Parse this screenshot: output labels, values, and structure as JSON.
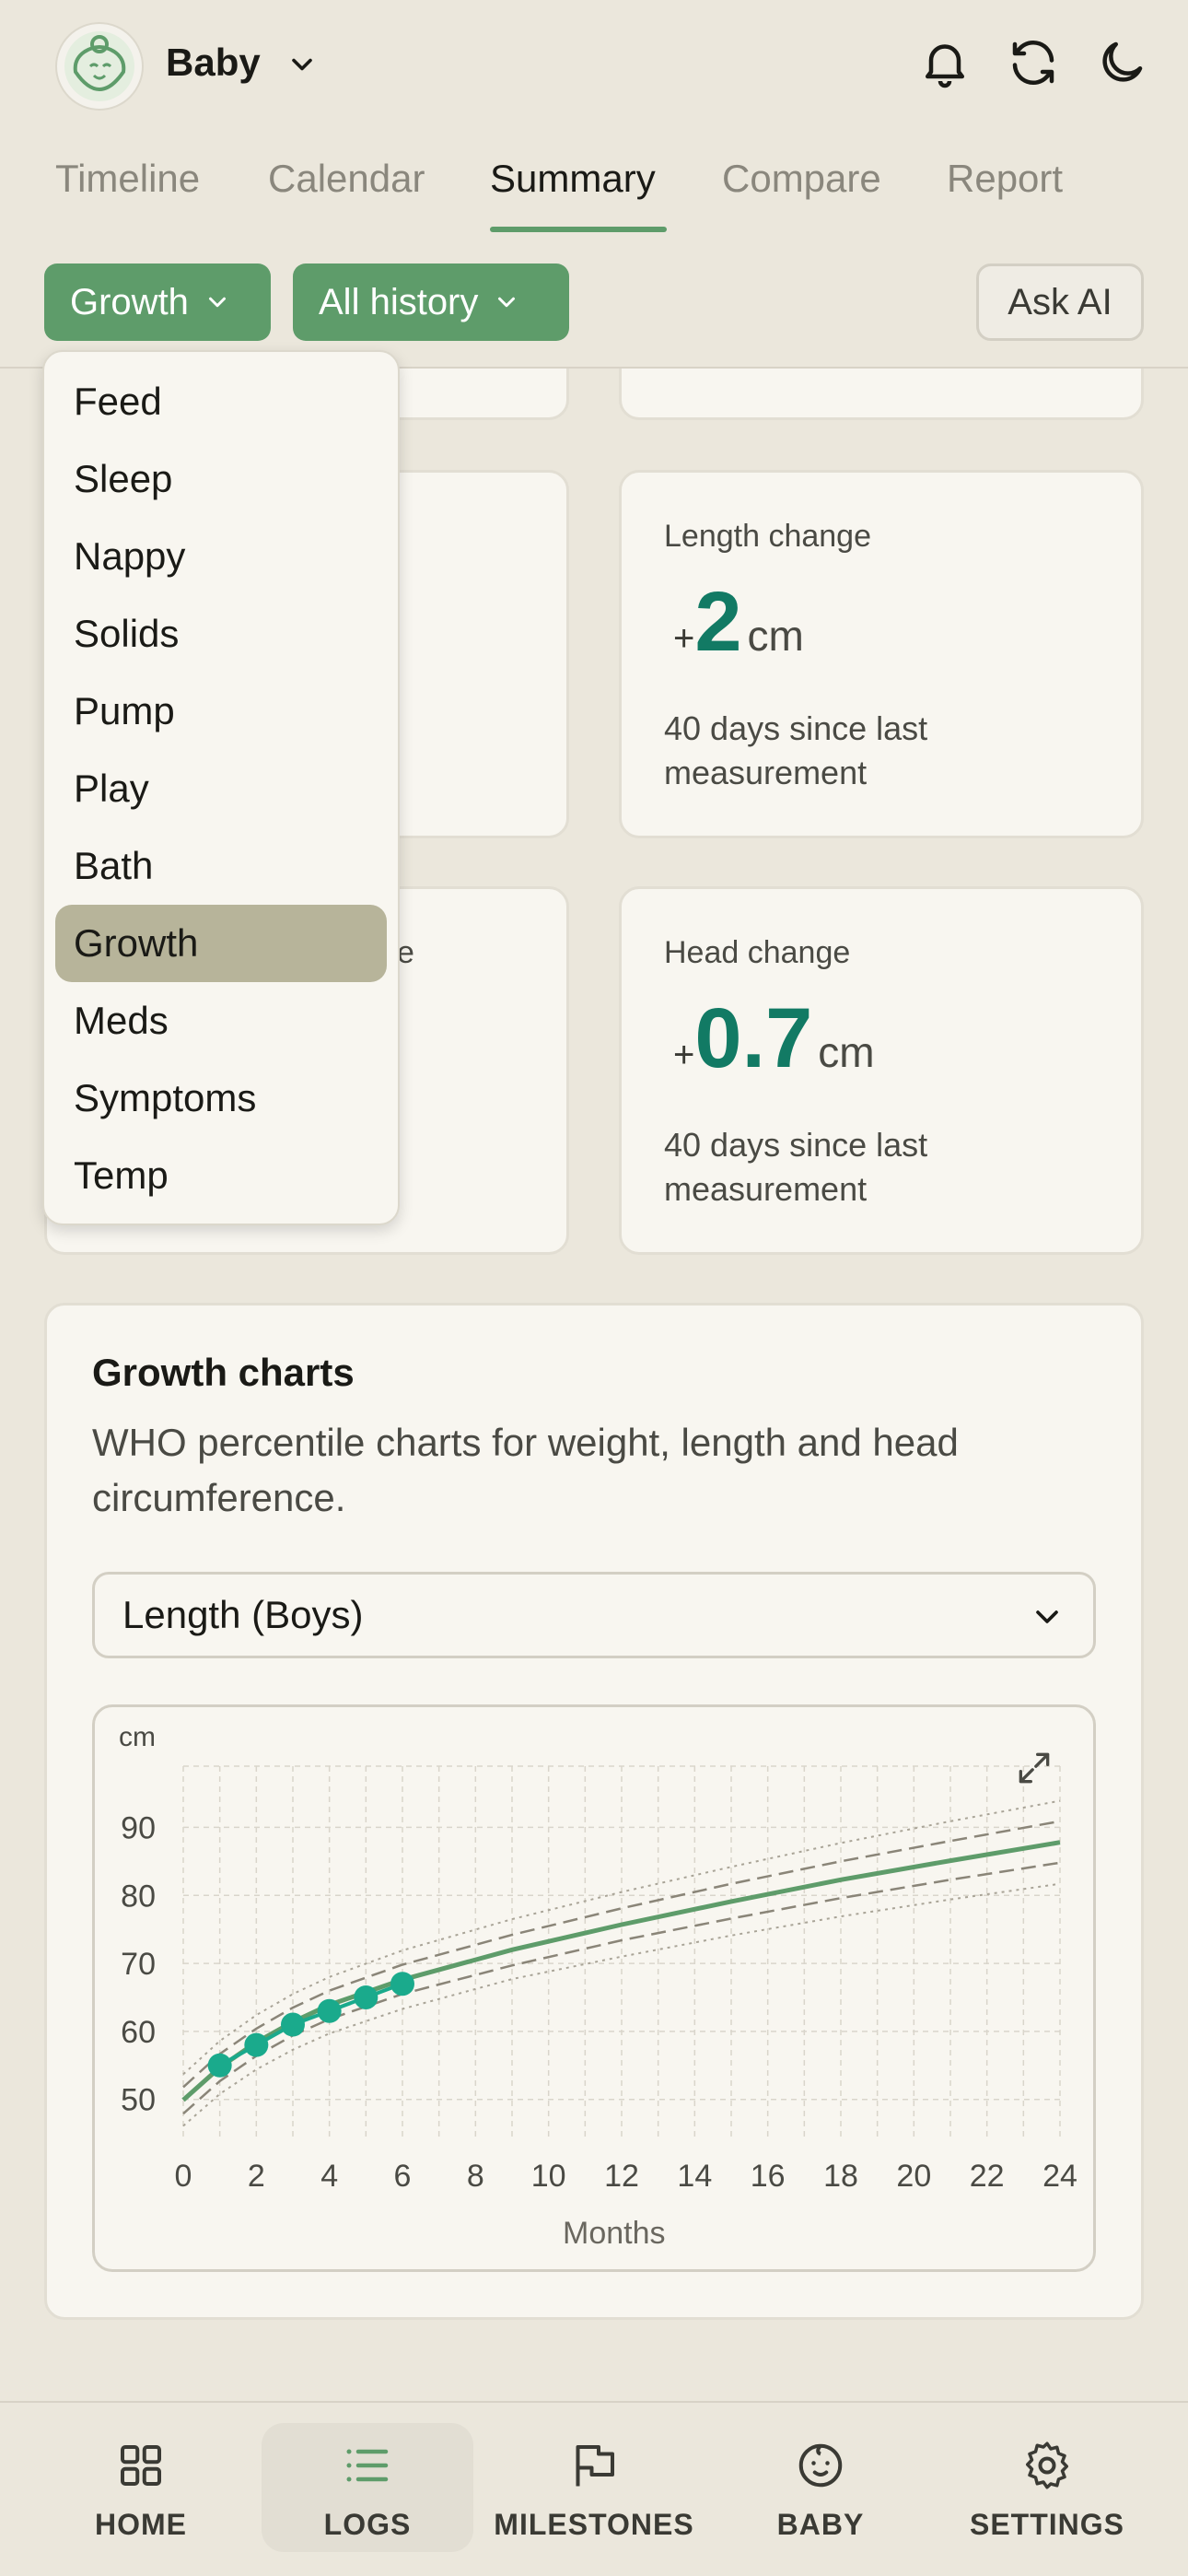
{
  "header": {
    "app_title": "Baby",
    "icons": [
      "bell-icon",
      "refresh-icon",
      "moon-icon"
    ]
  },
  "tabs": [
    {
      "label": "Timeline",
      "active": false
    },
    {
      "label": "Calendar",
      "active": false
    },
    {
      "label": "Summary",
      "active": true
    },
    {
      "label": "Compare",
      "active": false
    },
    {
      "label": "Report",
      "active": false
    }
  ],
  "filters": {
    "category": "Growth",
    "range": "All history",
    "ask_ai": "Ask AI"
  },
  "dropdown": {
    "items": [
      "Feed",
      "Sleep",
      "Nappy",
      "Solids",
      "Pump",
      "Play",
      "Bath",
      "Growth",
      "Meds",
      "Symptoms",
      "Temp"
    ],
    "selected": "Growth"
  },
  "cards": {
    "length": {
      "label": "Length change",
      "sign": "+",
      "value": "2",
      "unit": "cm",
      "note": "40 days since last measurement"
    },
    "head": {
      "label": "Head change",
      "sign": "+",
      "value": "0.7",
      "unit": "cm",
      "note": "40 days since last measurement"
    },
    "partial_suffix": "e"
  },
  "growth": {
    "title": "Growth charts",
    "description": "WHO percentile charts for weight, length and head circumference.",
    "selected_chart": "Length (Boys)"
  },
  "chart_data": {
    "type": "line",
    "xlabel": "Months",
    "ylabel": "cm",
    "xlim": [
      0,
      24
    ],
    "ylim": [
      44,
      99
    ],
    "x_ticks": [
      0,
      2,
      4,
      6,
      8,
      10,
      12,
      14,
      16,
      18,
      20,
      22,
      24
    ],
    "y_ticks": [
      50,
      60,
      70,
      80,
      90
    ],
    "grid": true,
    "percentile_curves": [
      {
        "name": "outer-low",
        "style": "dotted",
        "x": [
          0,
          1,
          2,
          3,
          4,
          6,
          9,
          12,
          15,
          18,
          21,
          24
        ],
        "y": [
          46.1,
          50.8,
          54.4,
          57.3,
          59.7,
          63.3,
          67.7,
          71.0,
          74.1,
          76.9,
          79.4,
          81.7
        ]
      },
      {
        "name": "low",
        "style": "dashed",
        "x": [
          0,
          1,
          2,
          3,
          4,
          6,
          9,
          12,
          15,
          18,
          21,
          24
        ],
        "y": [
          47.9,
          52.7,
          56.4,
          59.4,
          61.8,
          65.5,
          69.7,
          73.4,
          76.6,
          79.6,
          82.3,
          84.8
        ]
      },
      {
        "name": "median",
        "style": "solid",
        "x": [
          0,
          1,
          2,
          3,
          4,
          6,
          9,
          12,
          15,
          18,
          21,
          24
        ],
        "y": [
          49.9,
          54.7,
          58.4,
          61.4,
          63.9,
          67.6,
          72.0,
          75.7,
          79.1,
          82.3,
          85.1,
          87.8
        ]
      },
      {
        "name": "high",
        "style": "dashed",
        "x": [
          0,
          1,
          2,
          3,
          4,
          6,
          9,
          12,
          15,
          18,
          21,
          24
        ],
        "y": [
          51.8,
          56.7,
          60.4,
          63.5,
          66.0,
          69.8,
          74.2,
          78.1,
          81.7,
          85.0,
          88.0,
          90.9
        ]
      },
      {
        "name": "outer-high",
        "style": "dotted",
        "x": [
          0,
          1,
          2,
          3,
          4,
          6,
          9,
          12,
          15,
          18,
          21,
          24
        ],
        "y": [
          53.7,
          58.6,
          62.4,
          65.5,
          68.0,
          71.9,
          76.5,
          80.5,
          84.2,
          87.7,
          90.9,
          93.9
        ]
      }
    ],
    "measurements": {
      "x": [
        1,
        2,
        3,
        4,
        5,
        6
      ],
      "y": [
        55,
        58,
        61,
        63,
        65,
        67
      ]
    },
    "colors": {
      "median": "#5e9c6a",
      "percentile": "#8a8578",
      "measurement": "#1aaa8c",
      "grid": "#d9d5cb"
    }
  },
  "bottom_nav": [
    {
      "label": "HOME",
      "icon": "grid-icon",
      "active": false
    },
    {
      "label": "LOGS",
      "icon": "list-icon",
      "active": true
    },
    {
      "label": "MILESTONES",
      "icon": "flag-icon",
      "active": false
    },
    {
      "label": "BABY",
      "icon": "baby-face-icon",
      "active": false
    },
    {
      "label": "SETTINGS",
      "icon": "gear-icon",
      "active": false
    }
  ]
}
